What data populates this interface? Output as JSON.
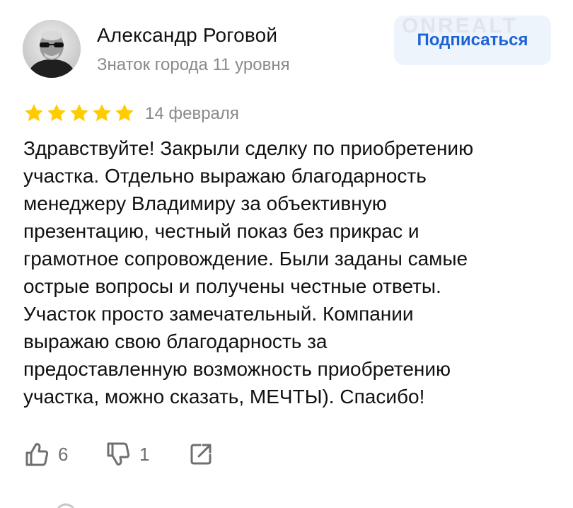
{
  "review": {
    "author": {
      "name": "Александр Роговой",
      "level": "Знаток города 11 уровня",
      "avatar_icon": "user-avatar-photo"
    },
    "subscribe_label": "Подписаться",
    "watermark": "ONREALT",
    "rating": 5,
    "rating_max": 5,
    "star_color": "#ffcc00",
    "date": "14 февраля",
    "text_lines": [
      "Здравствуйте! Закрыли сделку по приобретению",
      "участка. Отдельно выражаю благодарность",
      "менеджеру Владимиру за объективную",
      "презентацию, честный показ без прикрас и",
      "грамотное сопровождение. Были заданы самые",
      "острые вопросы и получены честные ответы.",
      "Участок просто замечательный. Компании",
      "выражаю свою благодарность за",
      "предоставленную возможность приобретению",
      "участка, можно сказать, МЕЧТЫ). Спасибо!"
    ],
    "actions": {
      "like_icon": "thumbs-up-icon",
      "like_count": "6",
      "dislike_icon": "thumbs-down-icon",
      "dislike_count": "1",
      "share_icon": "share-icon"
    }
  },
  "colors": {
    "accent": "#1e63d6",
    "button_bg": "#eef4fb",
    "secondary_text": "#8a8a8a",
    "icon": "#6f6f6f"
  }
}
